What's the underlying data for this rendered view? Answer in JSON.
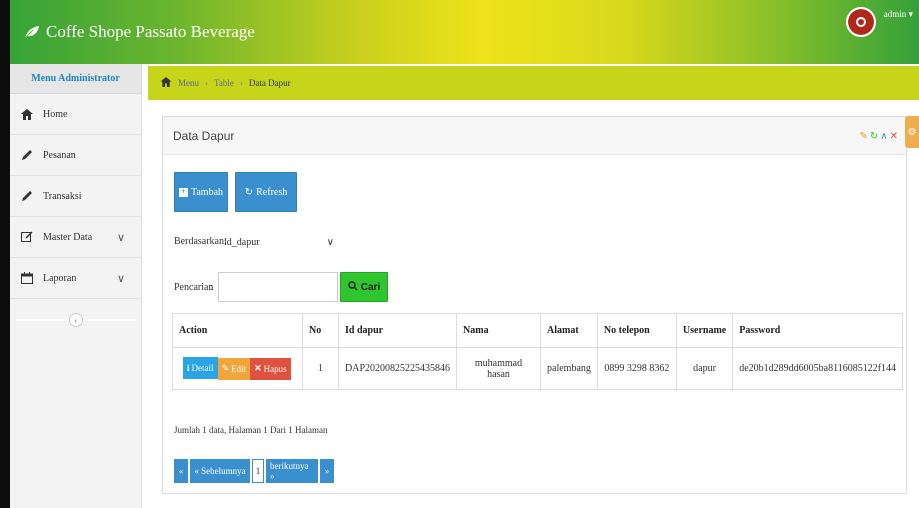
{
  "app": {
    "title": "Coffe Shope Passato Beverage",
    "user": "admin ▾"
  },
  "sidebar": {
    "header": "Menu Administrator",
    "items": [
      {
        "label": "Home",
        "icon": "home-icon"
      },
      {
        "label": "Pesanan",
        "icon": "pencil-icon"
      },
      {
        "label": "Transaksi",
        "icon": "pencil-icon"
      },
      {
        "label": "Master Data",
        "icon": "edit-icon",
        "chevron": "∨"
      },
      {
        "label": "Laporan",
        "icon": "calendar-icon",
        "chevron": "∨"
      }
    ]
  },
  "breadcrumb": [
    "Menu",
    "Table",
    "Data Dapur"
  ],
  "panel": {
    "title": "Data Dapur",
    "tool_icons": [
      "pencil-icon",
      "refresh-icon",
      "chevron-up-icon",
      "close-icon"
    ]
  },
  "toolbar": {
    "add_label": "Tambah",
    "refresh_label": "Refresh"
  },
  "filter": {
    "by_label": "Berdasarkan:",
    "by_value": "id_dapur",
    "search_label": "Pencarian",
    "search_colon": ":",
    "search_value": "",
    "search_button": "Cari"
  },
  "table": {
    "headers": [
      "Action",
      "No",
      "Id dapur",
      "Nama",
      "Alamat",
      "No telepon",
      "Username",
      "Password"
    ],
    "actions": [
      "Detail",
      "Edit",
      "Hapus"
    ],
    "rows": [
      {
        "no": "1",
        "id_dapur": "DAP20200825225435846",
        "nama": "muhammad hasan",
        "alamat": "palembang",
        "telepon": "0899 3298 8362",
        "username": "dapur",
        "password": "de20b1d289dd6005ba8116085122f144"
      }
    ]
  },
  "summary": "Jumlah 1 data, Halaman 1 Dari 1 Halaman",
  "pagination": {
    "first": "«",
    "prev": "« Sebelumnya",
    "current": "1",
    "next": "berikutnya »",
    "last": "»"
  },
  "colors": {
    "breadcrumb_bg": "#c7d51a",
    "primary": "#3a8fcf",
    "success": "#2ec52e",
    "info": "#2aa4e6",
    "warning": "#f0a63a",
    "danger": "#e0513f"
  }
}
